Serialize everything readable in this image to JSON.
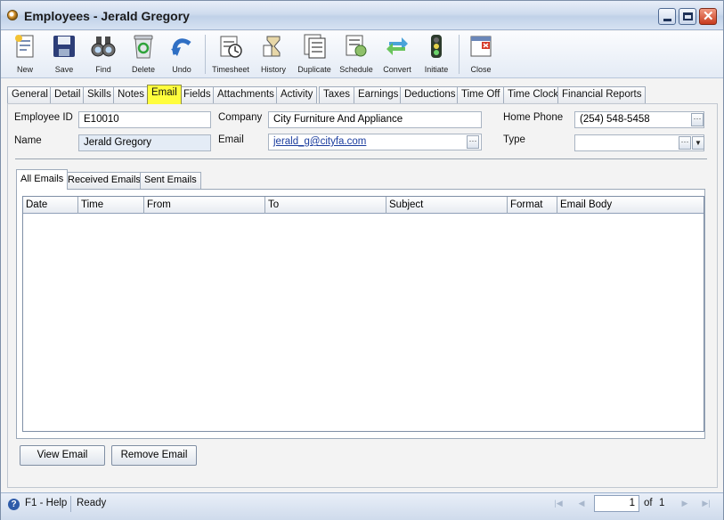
{
  "window": {
    "title": "Employees - Jerald Gregory",
    "close_glyph": "✕"
  },
  "toolbar": {
    "buttons": [
      {
        "label": "New",
        "icon": "new-document-icon"
      },
      {
        "label": "Save",
        "icon": "floppy-disk-icon"
      },
      {
        "label": "Find",
        "icon": "binoculars-icon"
      },
      {
        "label": "Delete",
        "icon": "recycle-bin-icon"
      },
      {
        "label": "Undo",
        "icon": "undo-arrow-icon"
      },
      {
        "label": "Timesheet",
        "icon": "timesheet-clock-icon"
      },
      {
        "label": "History",
        "icon": "history-icon"
      },
      {
        "label": "Duplicate",
        "icon": "duplicate-pages-icon"
      },
      {
        "label": "Schedule",
        "icon": "schedule-icon"
      },
      {
        "label": "Convert",
        "icon": "convert-arrows-icon"
      },
      {
        "label": "Initiate",
        "icon": "traffic-light-icon"
      },
      {
        "label": "Close",
        "icon": "close-window-icon"
      }
    ]
  },
  "tabs": [
    "General",
    "Detail",
    "Skills",
    "Notes",
    "Email",
    "Fields",
    "Attachments",
    "Activity",
    "Taxes",
    "Earnings",
    "Deductions",
    "Time Off",
    "Time Clock",
    "Financial Reports"
  ],
  "active_tab": "Email",
  "form": {
    "employee_id_label": "Employee ID",
    "employee_id": "E10010",
    "name_label": "Name",
    "name": "Jerald Gregory",
    "company_label": "Company",
    "company": "City Furniture And Appliance",
    "email_label": "Email",
    "email": "jerald_g@cityfa.com",
    "home_phone_label": "Home Phone",
    "home_phone": "(254) 548-5458",
    "type_label": "Type",
    "type": "",
    "ellipsis": "···",
    "dropdown_glyph": "▼"
  },
  "email_tabs": [
    "All Emails",
    "Received Emails",
    "Sent Emails"
  ],
  "grid": {
    "columns": [
      "Date",
      "Time",
      "From",
      "To",
      "Subject",
      "Format",
      "Email Body"
    ]
  },
  "buttons": {
    "view_email": "View Email",
    "remove_email": "Remove Email"
  },
  "statusbar": {
    "help_glyph": "?",
    "help": "F1 - Help",
    "status": "Ready",
    "page": "1",
    "of_label": "of",
    "total_pages": "1",
    "nav_first": "|◀",
    "nav_prev": "◀",
    "nav_next": "▶",
    "nav_last": "▶|"
  }
}
